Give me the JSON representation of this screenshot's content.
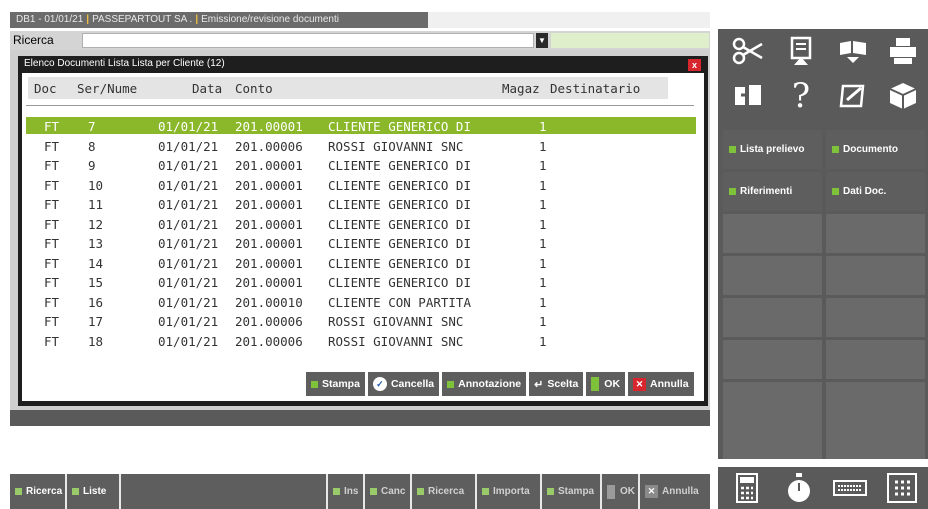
{
  "window": {
    "title_parts": [
      "DB1 - 01/01/21",
      "PASSEPARTOUT SA .",
      "Emissione/revisione documenti"
    ]
  },
  "search": {
    "label": "Ricerca",
    "value": "",
    "dropdown_icon": "down-arrow-icon"
  },
  "dialog": {
    "title": "Elenco Documenti Lista Lista per Cliente (12)",
    "close_label": "x",
    "columns": [
      "Doc",
      "Ser/Nume",
      "Data",
      "Conto",
      "Magaz",
      "Destinatario"
    ],
    "rows": [
      {
        "doc": "FT",
        "num": "7",
        "date": "01/01/21",
        "conto": "201.00001",
        "cliente": "CLIENTE GENERICO DI",
        "magaz": "1",
        "selected": true
      },
      {
        "doc": "FT",
        "num": "8",
        "date": "01/01/21",
        "conto": "201.00006",
        "cliente": "ROSSI GIOVANNI SNC",
        "magaz": "1"
      },
      {
        "doc": "FT",
        "num": "9",
        "date": "01/01/21",
        "conto": "201.00001",
        "cliente": "CLIENTE GENERICO DI",
        "magaz": "1"
      },
      {
        "doc": "FT",
        "num": "10",
        "date": "01/01/21",
        "conto": "201.00001",
        "cliente": "CLIENTE GENERICO DI",
        "magaz": "1"
      },
      {
        "doc": "FT",
        "num": "11",
        "date": "01/01/21",
        "conto": "201.00001",
        "cliente": "CLIENTE GENERICO DI",
        "magaz": "1"
      },
      {
        "doc": "FT",
        "num": "12",
        "date": "01/01/21",
        "conto": "201.00001",
        "cliente": "CLIENTE GENERICO DI",
        "magaz": "1"
      },
      {
        "doc": "FT",
        "num": "13",
        "date": "01/01/21",
        "conto": "201.00001",
        "cliente": "CLIENTE GENERICO DI",
        "magaz": "1"
      },
      {
        "doc": "FT",
        "num": "14",
        "date": "01/01/21",
        "conto": "201.00001",
        "cliente": "CLIENTE GENERICO DI",
        "magaz": "1"
      },
      {
        "doc": "FT",
        "num": "15",
        "date": "01/01/21",
        "conto": "201.00001",
        "cliente": "CLIENTE GENERICO DI",
        "magaz": "1"
      },
      {
        "doc": "FT",
        "num": "16",
        "date": "01/01/21",
        "conto": "201.00010",
        "cliente": "CLIENTE CON PARTITA",
        "magaz": "1"
      },
      {
        "doc": "FT",
        "num": "17",
        "date": "01/01/21",
        "conto": "201.00006",
        "cliente": "ROSSI GIOVANNI SNC",
        "magaz": "1"
      },
      {
        "doc": "FT",
        "num": "18",
        "date": "01/01/21",
        "conto": "201.00006",
        "cliente": "ROSSI GIOVANNI SNC",
        "magaz": "1"
      }
    ],
    "buttons": {
      "stampa": "Stampa",
      "cancella": "Cancella",
      "annotazione": "Annotazione",
      "scelta": "Scelta",
      "ok": "OK",
      "annulla": "Annulla"
    }
  },
  "sidebar": {
    "icons": [
      "scissors-icon",
      "paste-icon",
      "book-icon",
      "printer-icon",
      "window-split-icon",
      "help-icon",
      "edit-note-icon",
      "cube-icon"
    ],
    "help_glyph": "?",
    "tiles": {
      "lista_prelievo": "Lista prelievo",
      "documento": "Documento",
      "riferimenti": "Riferimenti",
      "dati_doc": "Dati Doc."
    }
  },
  "bottombar": {
    "ricerca": "Ricerca",
    "liste": "Liste",
    "ins": "Ins",
    "canc": "Canc",
    "ricerca2": "Ricerca",
    "importa": "Importa",
    "stampa": "Stampa",
    "ok": "OK",
    "annulla": "Annulla",
    "tools": [
      "calculator-icon",
      "stopwatch-icon",
      "keyboard-icon",
      "keypad-icon"
    ]
  },
  "colors": {
    "selection": "#8ab82a",
    "accent_green": "#7ec23a",
    "close_red": "#d8262e",
    "panel_dark": "#5a5a5a"
  }
}
